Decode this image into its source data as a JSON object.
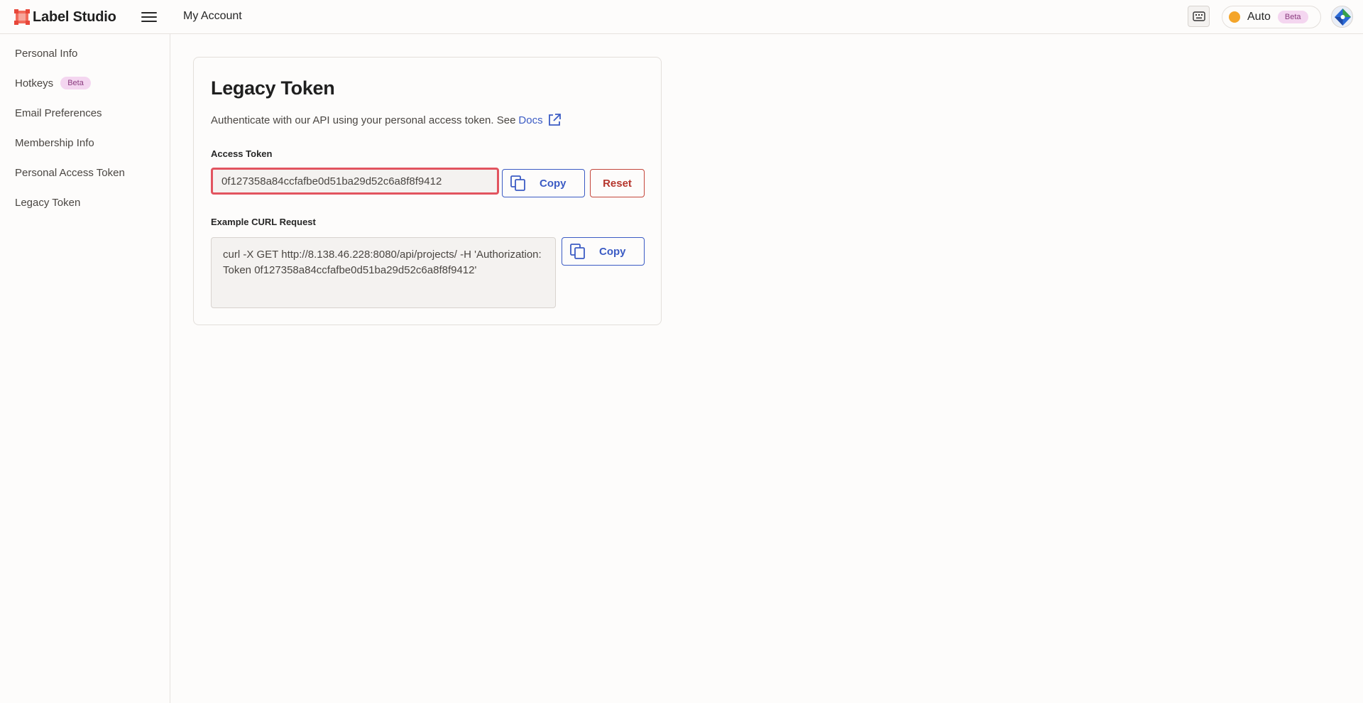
{
  "app": {
    "name": "Label Studio"
  },
  "header": {
    "page_title": "My Account",
    "theme": {
      "label": "Auto",
      "badge": "Beta"
    }
  },
  "sidebar": {
    "items": [
      {
        "label": "Personal Info"
      },
      {
        "label": "Hotkeys",
        "badge": "Beta"
      },
      {
        "label": "Email Preferences"
      },
      {
        "label": "Membership Info"
      },
      {
        "label": "Personal Access Token"
      },
      {
        "label": "Legacy Token"
      }
    ]
  },
  "card": {
    "title": "Legacy Token",
    "description": "Authenticate with our API using your personal access token. See",
    "docs_link": "Docs",
    "access_token": {
      "label": "Access Token",
      "value": "0f127358a84ccfafbe0d51ba29d52c6a8f8f9412",
      "copy_label": "Copy",
      "reset_label": "Reset"
    },
    "curl": {
      "label": "Example CURL Request",
      "value": "curl -X GET http://8.138.46.228:8080/api/projects/ -H 'Authorization: Token 0f127358a84ccfafbe0d51ba29d52c6a8f8f9412'",
      "copy_label": "Copy"
    }
  },
  "colors": {
    "accent": "#3b5bc4",
    "danger": "#b5352c",
    "highlight_border": "#e2545f",
    "theme_dot": "#f4a52a",
    "beta_bg": "#f4d6f0"
  },
  "icons": {
    "logo": "label-studio-logo-icon",
    "menu": "hamburger-menu-icon",
    "keyboard": "keyboard-icon",
    "external": "external-link-icon",
    "copy": "copy-icon"
  }
}
